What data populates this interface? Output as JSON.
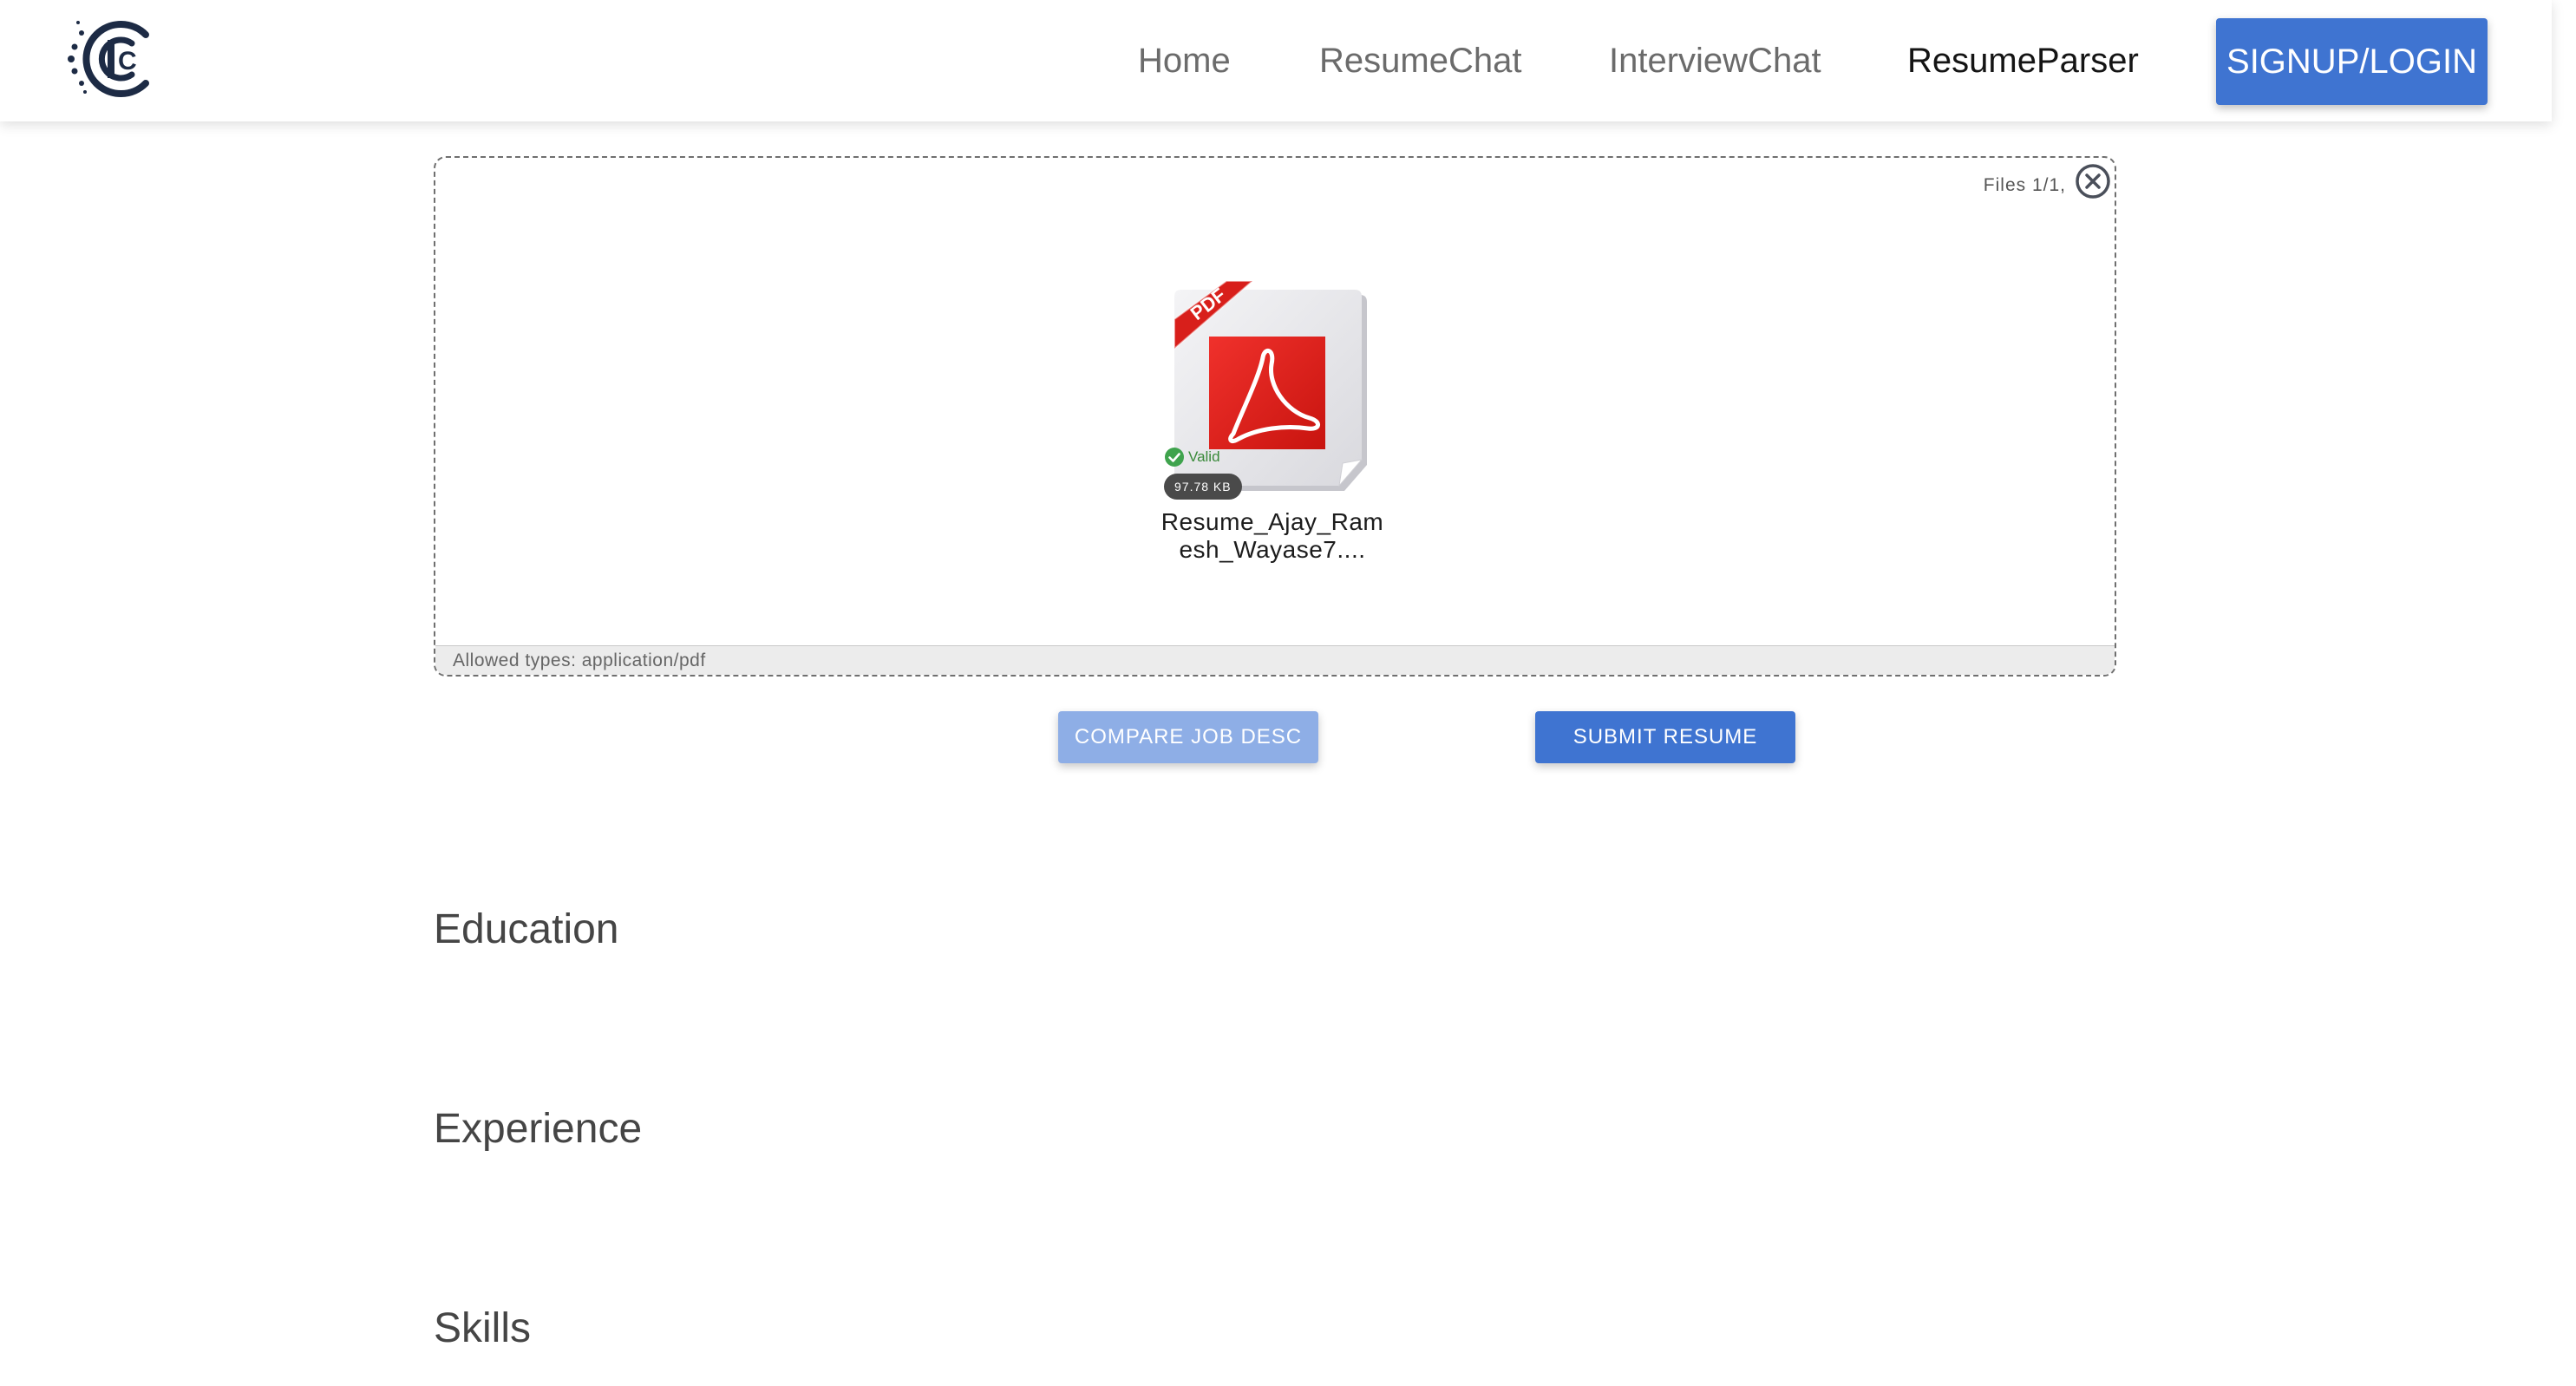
{
  "header": {
    "logo_letter": "C",
    "nav": {
      "home": "Home",
      "resume_chat": "ResumeChat",
      "interview_chat": "InterviewChat",
      "resume_parser": "ResumeParser"
    },
    "active_nav": "resume_parser",
    "signup_login": "SIGNUP/LOGIN"
  },
  "uploader": {
    "files_count": "Files 1/1,",
    "file": {
      "icon": "pdf-file-icon",
      "badge_label": "PDF",
      "status": "Valid",
      "size": "97.78 KB",
      "name": "Resume_Ajay_Ramesh_Wayase7...."
    },
    "allowed_types": "Allowed types: application/pdf"
  },
  "actions": {
    "compare_job_desc": "COMPARE JOB DESC",
    "submit_resume": "SUBMIT RESUME"
  },
  "sections": {
    "education": "Education",
    "experience": "Experience",
    "skills": "Skills"
  },
  "colors": {
    "primary": "#3f74d1",
    "primary_disabled": "#8eaee6",
    "pdf_red": "#e0231f",
    "valid_green": "#3fa34d"
  }
}
